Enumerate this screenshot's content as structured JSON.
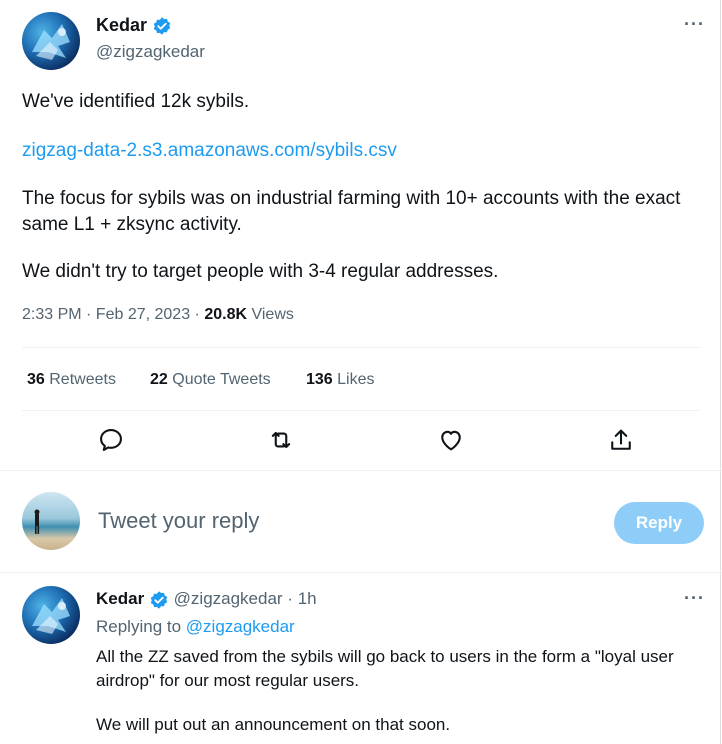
{
  "tweet": {
    "author_name": "Kedar",
    "author_handle": "@zigzagkedar",
    "text_line1": "We've identified 12k sybils.",
    "link": "zigzag-data-2.s3.amazonaws.com/sybils.csv",
    "text_para2": "The focus for sybils was on industrial farming with 10+ accounts with the exact same L1 + zksync activity.",
    "text_para3": "We didn't try to target people with 3-4 regular addresses.",
    "timestamp": "2:33 PM · Feb 27, 2023 · ",
    "views_count": "20.8K",
    "views_label": " Views",
    "more_label": "···"
  },
  "stats": {
    "retweets_count": "36",
    "retweets_label": " Retweets",
    "quotes_count": "22",
    "quotes_label": " Quote Tweets",
    "likes_count": "136",
    "likes_label": " Likes"
  },
  "actions": [
    "reply-icon",
    "retweet-icon",
    "like-icon",
    "share-icon"
  ],
  "composer": {
    "placeholder": "Tweet your reply",
    "button_label": "Reply"
  },
  "reply": {
    "author_name": "Kedar",
    "author_handle": "@zigzagkedar",
    "time": " · 1h",
    "replying_to_prefix": "Replying to ",
    "replying_to_handle": "@zigzagkedar",
    "text_para1": "All the ZZ saved from the sybils will go back to users in the form a \"loyal user airdrop\" for our most regular users.",
    "text_para2": "We will put out an announcement on that soon.",
    "more_label": "···"
  },
  "colors": {
    "accent": "#1d9bf0",
    "muted": "#536471",
    "reply_button": "#8ecdf8"
  }
}
